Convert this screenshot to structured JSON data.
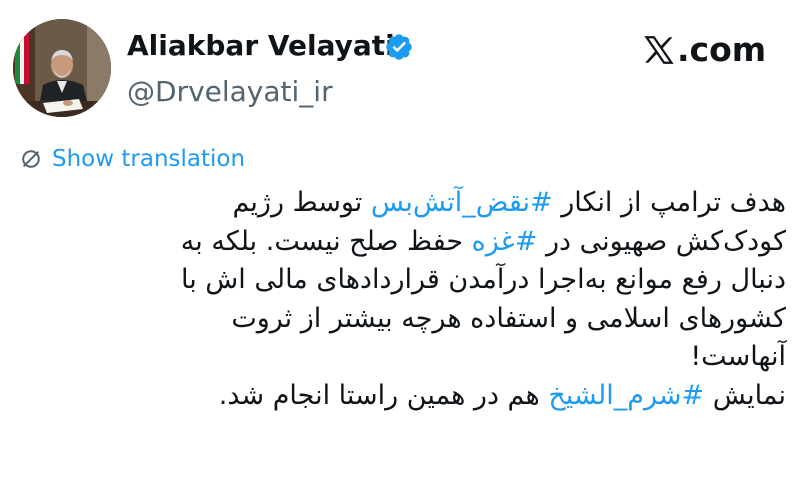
{
  "author": {
    "display_name": "Aliakbar Velayati",
    "handle": "@Drvelayati_ir",
    "verified_icon": "verified-badge-icon",
    "avatar_icon": "profile-photo"
  },
  "site": {
    "label": ".com",
    "logo_icon": "x-logo-icon"
  },
  "translation": {
    "label": "Show translation",
    "icon": "translate-globe-icon"
  },
  "tweet": {
    "lines": [
      {
        "pre": "هدف ترامپ از انکار ",
        "hashtag": "#نقض_آتش‌بس",
        "post": " توسط رژیم"
      },
      {
        "pre": "کودک‌کش صهیونی در ",
        "hashtag": "#غزه",
        "post": " حفظ صلح نیست. بلکه به"
      },
      {
        "text": "دنبال رفع موانع به‌اجرا درآمدن قراردادهای مالی اش با"
      },
      {
        "text": "کشورهای اسلامی و استفاده هرچه بیشتر از ثروت"
      },
      {
        "text": "آنهاست!"
      },
      {
        "pre": "نمایش ",
        "hashtag": "#شرم_الشیخ",
        "post": " هم در همین راستا انجام شد."
      }
    ]
  },
  "colors": {
    "link": "#1d9bf0",
    "text": "#0f1419",
    "secondary": "#536471",
    "verified": "#1d9bf0"
  }
}
